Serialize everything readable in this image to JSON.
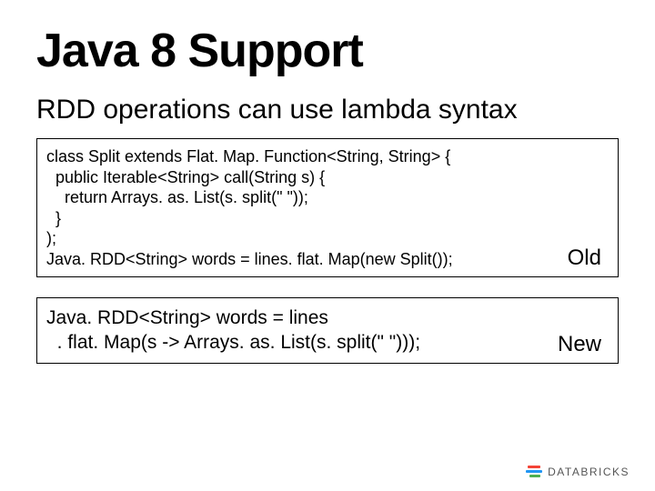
{
  "title": "Java 8 Support",
  "subtitle": "RDD operations can use lambda syntax",
  "old_box": {
    "code": "class Split extends Flat. Map. Function<String, String> {\n  public Iterable<String> call(String s) {\n    return Arrays. as. List(s. split(\" \"));\n  }\n);\nJava. RDD<String> words = lines. flat. Map(new Split());",
    "label": "Old"
  },
  "new_box": {
    "code": "Java. RDD<String> words = lines\n  . flat. Map(s -> Arrays. as. List(s. split(\" \")));",
    "label": "New"
  },
  "footer": {
    "brand": "DATABRICKS"
  }
}
